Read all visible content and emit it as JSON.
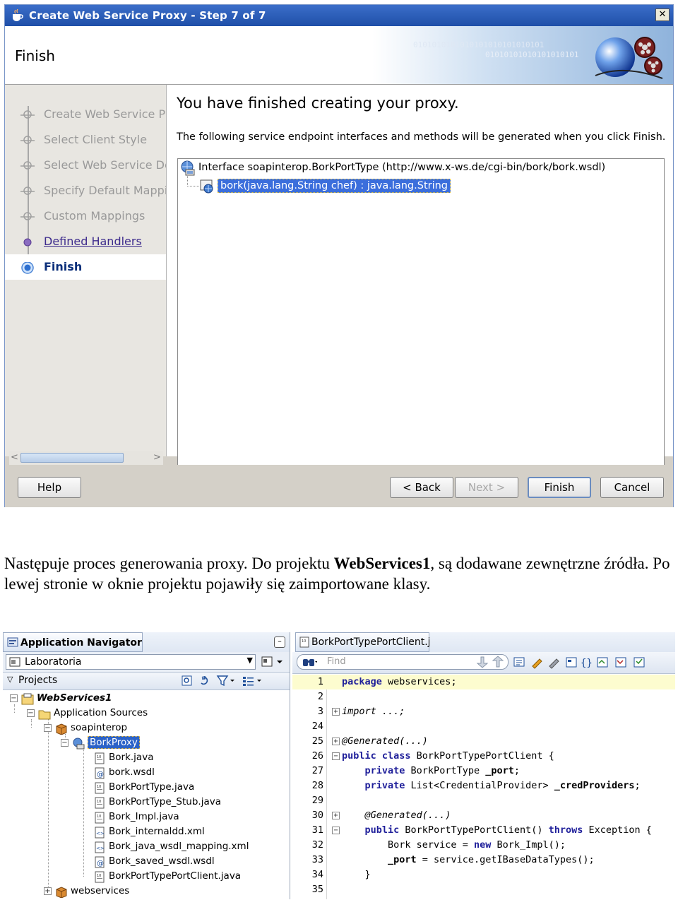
{
  "wizard": {
    "title": "Create Web Service Proxy - Step 7 of 7",
    "close_label": "✕",
    "banner_title": "Finish",
    "banner_binary_1": "0101010101010101010101010101",
    "banner_binary_2": "01010101010101010101",
    "steps": [
      {
        "label": "Create Web Service Proxy",
        "state": "done"
      },
      {
        "label": "Select Client Style",
        "state": "done"
      },
      {
        "label": "Select Web Service Description",
        "state": "done"
      },
      {
        "label": "Specify Default Mapping Options",
        "state": "done"
      },
      {
        "label": "Custom Mappings",
        "state": "done"
      },
      {
        "label": "Defined Handlers",
        "state": "visited"
      },
      {
        "label": "Finish",
        "state": "current"
      }
    ],
    "headline": "You have finished creating your proxy.",
    "description": "The following service endpoint interfaces and methods will be generated when you click Finish.",
    "tree": {
      "interface": "Interface soapinterop.BorkPortType (http://www.x-ws.de/cgi-bin/bork/bork.wsdl)",
      "method": "bork(java.lang.String chef) : java.lang.String"
    },
    "buttons": {
      "help": "Help",
      "back": "< Back",
      "next": "Next >",
      "finish": "Finish",
      "cancel": "Cancel"
    }
  },
  "paragraph": {
    "part1": "Następuje proces generowania proxy. Do projektu ",
    "bold": "WebServices1",
    "part2": ", są dodawane zewnętrzne źródła. Po lewej stronie w oknie projektu pojawiły się zaimportowane klasy."
  },
  "navigator": {
    "tab_title": "Application Navigator",
    "minimize_label": "–",
    "app_combo": "Laboratoria",
    "projects_label": "Projects",
    "tree": [
      {
        "label": "WebServices1",
        "icon": "project-icon",
        "expanded": true
      },
      {
        "label": "Application Sources",
        "icon": "folder-icon",
        "expanded": true
      },
      {
        "label": "soapinterop",
        "icon": "package-icon",
        "expanded": true
      },
      {
        "label": "BorkProxy",
        "icon": "proxy-icon",
        "expanded": true,
        "selected": true
      },
      {
        "label": "Bork.java",
        "icon": "java-file-icon"
      },
      {
        "label": "bork.wsdl",
        "icon": "wsdl-file-icon"
      },
      {
        "label": "BorkPortType.java",
        "icon": "java-file-icon"
      },
      {
        "label": "BorkPortType_Stub.java",
        "icon": "java-file-icon"
      },
      {
        "label": "Bork_Impl.java",
        "icon": "java-file-icon"
      },
      {
        "label": "Bork_internaldd.xml",
        "icon": "xml-file-icon"
      },
      {
        "label": "Bork_java_wsdl_mapping.xml",
        "icon": "xml-file-icon"
      },
      {
        "label": "Bork_saved_wsdl.wsdl",
        "icon": "wsdl-file-icon"
      },
      {
        "label": "BorkPortTypePortClient.java",
        "icon": "java-file-icon"
      },
      {
        "label": "webservices",
        "icon": "package-icon",
        "expanded": false
      }
    ]
  },
  "editor": {
    "tab_title": "BorkPortTypePortClient.java",
    "find_placeholder": "Find",
    "lines": [
      {
        "n": "1",
        "fold": "",
        "indent": "",
        "tokens": [
          [
            "kw",
            "package"
          ],
          [
            "t",
            " webservices;"
          ]
        ]
      },
      {
        "n": "2",
        "fold": "",
        "indent": "",
        "tokens": []
      },
      {
        "n": "3",
        "fold": "+",
        "indent": "",
        "tokens": [
          [
            "an",
            "import ...;"
          ]
        ]
      },
      {
        "n": "24",
        "fold": "",
        "indent": "",
        "tokens": []
      },
      {
        "n": "25",
        "fold": "+",
        "indent": "",
        "tokens": [
          [
            "an",
            "@Generated(...)"
          ]
        ]
      },
      {
        "n": "26",
        "fold": "-",
        "indent": "",
        "tokens": [
          [
            "kw",
            "public class"
          ],
          [
            "t",
            " BorkPortTypePortClient {"
          ]
        ]
      },
      {
        "n": "27",
        "fold": "",
        "indent": "    ",
        "tokens": [
          [
            "kw",
            "private"
          ],
          [
            "t",
            " BorkPortType "
          ],
          [
            "b",
            "_port"
          ],
          [
            "t",
            ";"
          ]
        ]
      },
      {
        "n": "28",
        "fold": "",
        "indent": "    ",
        "tokens": [
          [
            "kw",
            "private"
          ],
          [
            "t",
            " List<CredentialProvider> "
          ],
          [
            "b",
            "_credProviders"
          ],
          [
            "t",
            ";"
          ]
        ]
      },
      {
        "n": "29",
        "fold": "",
        "indent": "",
        "tokens": []
      },
      {
        "n": "30",
        "fold": "+",
        "indent": "    ",
        "tokens": [
          [
            "an",
            "@Generated(...)"
          ]
        ]
      },
      {
        "n": "31",
        "fold": "-",
        "indent": "    ",
        "tokens": [
          [
            "kw",
            "public"
          ],
          [
            "t",
            " BorkPortTypePortClient() "
          ],
          [
            "kw",
            "throws"
          ],
          [
            "t",
            " Exception {"
          ]
        ]
      },
      {
        "n": "32",
        "fold": "",
        "indent": "        ",
        "tokens": [
          [
            "t",
            "Bork service = "
          ],
          [
            "kw",
            "new"
          ],
          [
            "t",
            " Bork_Impl();"
          ]
        ]
      },
      {
        "n": "33",
        "fold": "",
        "indent": "        ",
        "tokens": [
          [
            "b",
            "_port"
          ],
          [
            "t",
            " = service.getIBaseDataTypes();"
          ]
        ]
      },
      {
        "n": "34",
        "fold": "",
        "indent": "    ",
        "tokens": [
          [
            "t",
            "}"
          ]
        ]
      },
      {
        "n": "35",
        "fold": "",
        "indent": "",
        "tokens": []
      }
    ]
  },
  "colors": {
    "title_bar": "#2a5bb8",
    "selection": "#2b62c8",
    "keyword": "#1f1f9a",
    "current_line": "#fdfccf"
  }
}
